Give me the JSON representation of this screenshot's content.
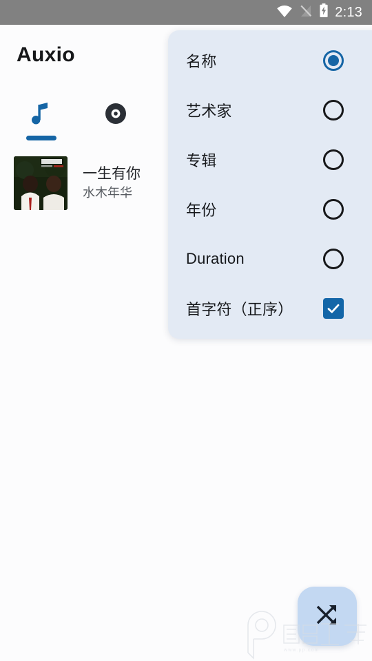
{
  "status_bar": {
    "time": "2:13",
    "icons": [
      "wifi-icon",
      "signal-off-icon",
      "battery-charging-icon"
    ],
    "background_color": "#818181"
  },
  "app": {
    "title": "Auxio",
    "accent_color": "#1565a5",
    "background_color": "#fcfcfd"
  },
  "tabs": [
    {
      "name": "songs",
      "icon": "music-note-icon",
      "selected": true
    },
    {
      "name": "albums",
      "icon": "disc-icon",
      "selected": false
    }
  ],
  "song_list": [
    {
      "title": "一生有你",
      "artist": "水木年华",
      "artwork": "album-art-shuimu-nianhua"
    }
  ],
  "sort_menu": {
    "background_color": "#e3eaf4",
    "items": [
      {
        "label": "名称",
        "control": "radio",
        "checked": true
      },
      {
        "label": "艺术家",
        "control": "radio",
        "checked": false
      },
      {
        "label": "专辑",
        "control": "radio",
        "checked": false
      },
      {
        "label": "年份",
        "control": "radio",
        "checked": false
      },
      {
        "label": "Duration",
        "control": "radio",
        "checked": false
      },
      {
        "label": "首字符（正序）",
        "control": "checkbox",
        "checked": true
      }
    ]
  },
  "fab": {
    "icon": "shuffle-icon",
    "background_color": "#c3d8f2"
  },
  "watermark": {
    "text": "精品下载",
    "sub_text": "www.pp.com",
    "logo": "p-logo-icon"
  }
}
